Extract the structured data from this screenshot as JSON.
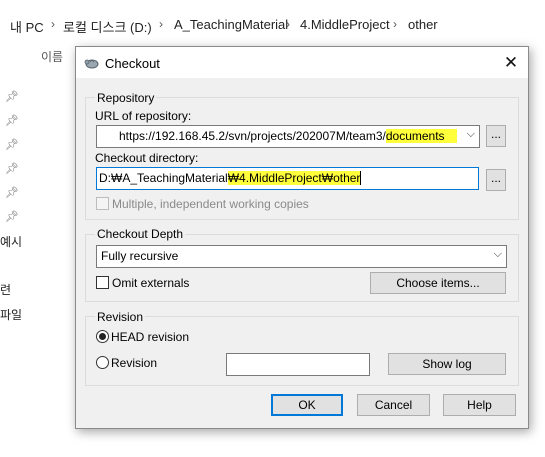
{
  "explorer": {
    "breadcrumb": [
      "내 PC",
      "로컬 디스크 (D:)",
      "A_TeachingMaterial",
      "4.MiddleProject",
      "other"
    ],
    "column_header": "이름",
    "side_texts": [
      "예시",
      "련",
      "파일"
    ]
  },
  "dialog": {
    "title": "Checkout",
    "repository": {
      "group_label": "Repository",
      "url_label": "URL of repository:",
      "url_prefix": "https://192.168.45.2/svn/projects/202007M/team3/",
      "url_highlight": "documents",
      "browse_label": "...",
      "dir_label": "Checkout directory:",
      "dir_prefix": "D:₩A_TeachingMaterial",
      "dir_highlight": "₩4.MiddleProject₩other",
      "dir_browse_label": "...",
      "multiple_label": "Multiple, independent working copies",
      "multiple_checked": false
    },
    "depth": {
      "group_label": "Checkout Depth",
      "selected": "Fully recursive",
      "omit_externals_label": "Omit externals",
      "omit_externals_checked": false,
      "choose_items_label": "Choose items..."
    },
    "revision": {
      "group_label": "Revision",
      "head_label": "HEAD revision",
      "revision_label": "Revision",
      "selected": "HEAD revision",
      "revision_value": "",
      "show_log_label": "Show log"
    },
    "buttons": {
      "ok": "OK",
      "cancel": "Cancel",
      "help": "Help"
    }
  }
}
